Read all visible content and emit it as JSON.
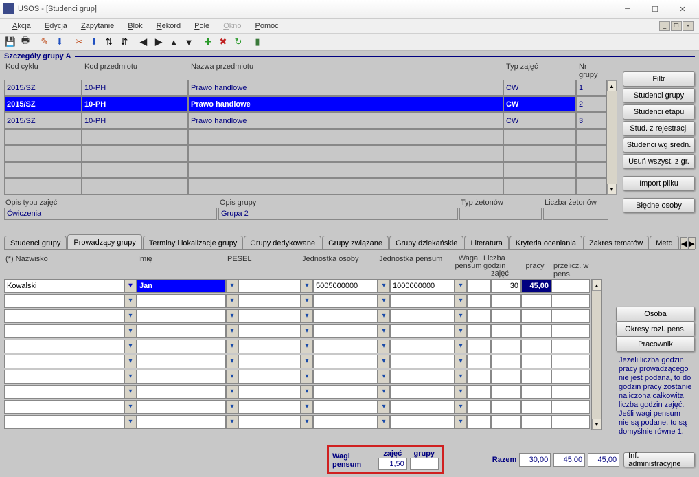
{
  "window": {
    "title": "USOS - [Studenci grup]"
  },
  "menu": {
    "items": [
      "Akcja",
      "Edycja",
      "Zapytanie",
      "Blok",
      "Rekord",
      "Pole",
      "Okno",
      "Pomoc"
    ],
    "disabled_index": 6
  },
  "section": {
    "title": "Szczegóły grupy  A"
  },
  "upper": {
    "headers": [
      "Kod cyklu",
      "Kod przedmiotu",
      "Nazwa przedmiotu",
      "Typ zajęć",
      "Nr grupy"
    ],
    "rows": [
      {
        "cykl": "2015/SZ",
        "kod": "10-PH",
        "nazwa": "Prawo handlowe",
        "typ": "CW",
        "nr": "1",
        "selected": false
      },
      {
        "cykl": "2015/SZ",
        "kod": "10-PH",
        "nazwa": "Prawo handlowe",
        "typ": "CW",
        "nr": "2",
        "selected": true
      },
      {
        "cykl": "2015/SZ",
        "kod": "10-PH",
        "nazwa": "Prawo handlowe",
        "typ": "CW",
        "nr": "3",
        "selected": false
      },
      {
        "cykl": "",
        "kod": "",
        "nazwa": "",
        "typ": "",
        "nr": "",
        "selected": false
      },
      {
        "cykl": "",
        "kod": "",
        "nazwa": "",
        "typ": "",
        "nr": "",
        "selected": false
      },
      {
        "cykl": "",
        "kod": "",
        "nazwa": "",
        "typ": "",
        "nr": "",
        "selected": false
      },
      {
        "cykl": "",
        "kod": "",
        "nazwa": "",
        "typ": "",
        "nr": "",
        "selected": false
      }
    ]
  },
  "side_buttons": [
    "Filtr",
    "Studenci grupy",
    "Studenci etapu",
    "Stud. z rejestracji",
    "Studenci wg średn.",
    "Usuń wszyst. z gr.",
    "Import pliku",
    "Błędne osoby"
  ],
  "opis": {
    "typ_label": "Opis typu zajęć",
    "typ_value": "Ćwiczenia",
    "grupa_label": "Opis grupy",
    "grupa_value": "Grupa 2",
    "zeton_typ_label": "Typ żetonów",
    "zeton_typ_value": "",
    "zeton_liczba_label": "Liczba żetonów",
    "zeton_liczba_value": ""
  },
  "tabs": [
    "Studenci grupy",
    "Prowadzący grupy",
    "Terminy i lokalizacje grupy",
    "Grupy dedykowane",
    "Grupy związane",
    "Grupy dziekańskie",
    "Literatura",
    "Kryteria oceniania",
    "Zakres tematów",
    "Metd"
  ],
  "active_tab_index": 1,
  "lower": {
    "headers": {
      "nazwisko": "(*) Nazwisko",
      "imie": "Imię",
      "pesel": "PESEL",
      "jo": "Jednostka osoby",
      "jp": "Jednostka pensum",
      "waga1": "Waga",
      "waga2": "pensum",
      "godz1": "Liczba godzin",
      "godz2": "zajęć",
      "pracy": "pracy",
      "przelicz": "przelicz. w pens."
    },
    "rows": [
      {
        "nazwisko": "Kowalski",
        "imie": "Jan",
        "pesel": "",
        "jo": "5005000000",
        "jp": "1000000000",
        "waga": "",
        "godz": "30",
        "pracy": "45,00",
        "przelicz": ""
      },
      {
        "nazwisko": "",
        "imie": "",
        "pesel": "",
        "jo": "",
        "jp": "",
        "waga": "",
        "godz": "",
        "pracy": "",
        "przelicz": ""
      },
      {
        "nazwisko": "",
        "imie": "",
        "pesel": "",
        "jo": "",
        "jp": "",
        "waga": "",
        "godz": "",
        "pracy": "",
        "przelicz": ""
      },
      {
        "nazwisko": "",
        "imie": "",
        "pesel": "",
        "jo": "",
        "jp": "",
        "waga": "",
        "godz": "",
        "pracy": "",
        "przelicz": ""
      },
      {
        "nazwisko": "",
        "imie": "",
        "pesel": "",
        "jo": "",
        "jp": "",
        "waga": "",
        "godz": "",
        "pracy": "",
        "przelicz": ""
      },
      {
        "nazwisko": "",
        "imie": "",
        "pesel": "",
        "jo": "",
        "jp": "",
        "waga": "",
        "godz": "",
        "pracy": "",
        "przelicz": ""
      },
      {
        "nazwisko": "",
        "imie": "",
        "pesel": "",
        "jo": "",
        "jp": "",
        "waga": "",
        "godz": "",
        "pracy": "",
        "przelicz": ""
      },
      {
        "nazwisko": "",
        "imie": "",
        "pesel": "",
        "jo": "",
        "jp": "",
        "waga": "",
        "godz": "",
        "pracy": "",
        "przelicz": ""
      },
      {
        "nazwisko": "",
        "imie": "",
        "pesel": "",
        "jo": "",
        "jp": "",
        "waga": "",
        "godz": "",
        "pracy": "",
        "przelicz": ""
      },
      {
        "nazwisko": "",
        "imie": "",
        "pesel": "",
        "jo": "",
        "jp": "",
        "waga": "",
        "godz": "",
        "pracy": "",
        "przelicz": ""
      }
    ]
  },
  "lower_right_buttons": [
    "Osoba",
    "Okresy rozl. pens.",
    "Pracownik"
  ],
  "info_text": "Jeżeli liczba godzin pracy prowadzącego nie jest podana, to do godzin pracy zostanie naliczona całkowita liczba godzin zajęć. Jeśli wagi pensum nie są podane, to są domyślnie równe 1.",
  "bottom": {
    "wagi_label": "Wagi pensum",
    "zajec_label": "zajęć",
    "zajec_value": "1,50",
    "grupy_label": "grupy",
    "grupy_value": "",
    "razem_label": "Razem",
    "razem_godz": "30,00",
    "razem_pracy": "45,00",
    "razem_przelicz": "45,00",
    "inf_btn": "Inf. administracyjne"
  }
}
